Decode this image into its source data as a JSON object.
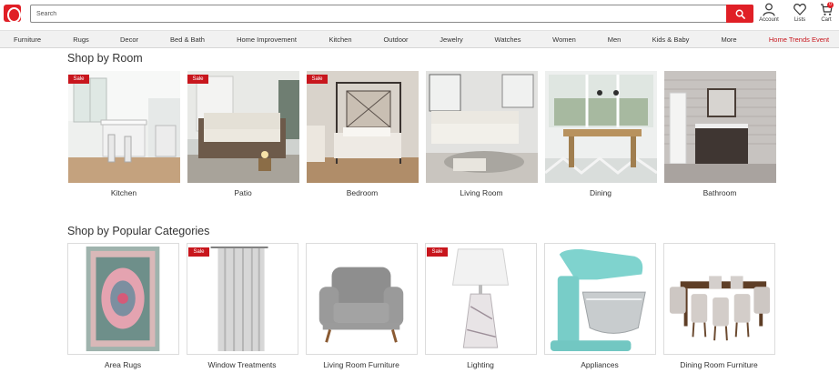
{
  "header": {
    "search_placeholder": "Search",
    "account_label": "Account",
    "lists_label": "Lists",
    "cart_label": "Cart",
    "cart_count": "0"
  },
  "nav": {
    "items": [
      "Furniture",
      "Rugs",
      "Decor",
      "Bed & Bath",
      "Home Improvement",
      "Kitchen",
      "Outdoor",
      "Jewelry",
      "Watches",
      "Women",
      "Men",
      "Kids & Baby",
      "More",
      "Home Trends Event"
    ]
  },
  "rooms": {
    "title": "Shop by Room",
    "sale_label": "Sale",
    "items": [
      "Kitchen",
      "Patio",
      "Bedroom",
      "Living Room",
      "Dining",
      "Bathroom"
    ]
  },
  "categories": {
    "title": "Shop by Popular Categories",
    "sale_label": "Sale",
    "items": [
      "Area Rugs",
      "Window Treatments",
      "Living Room Furniture",
      "Lighting",
      "Appliances",
      "Dining Room Furniture"
    ]
  },
  "colors": {
    "brand_red": "#e01f26",
    "sale_red": "#c8161d",
    "nav_bg": "#f1f1f1"
  },
  "icons": [
    "search-icon",
    "account-icon",
    "heart-icon",
    "cart-icon"
  ]
}
